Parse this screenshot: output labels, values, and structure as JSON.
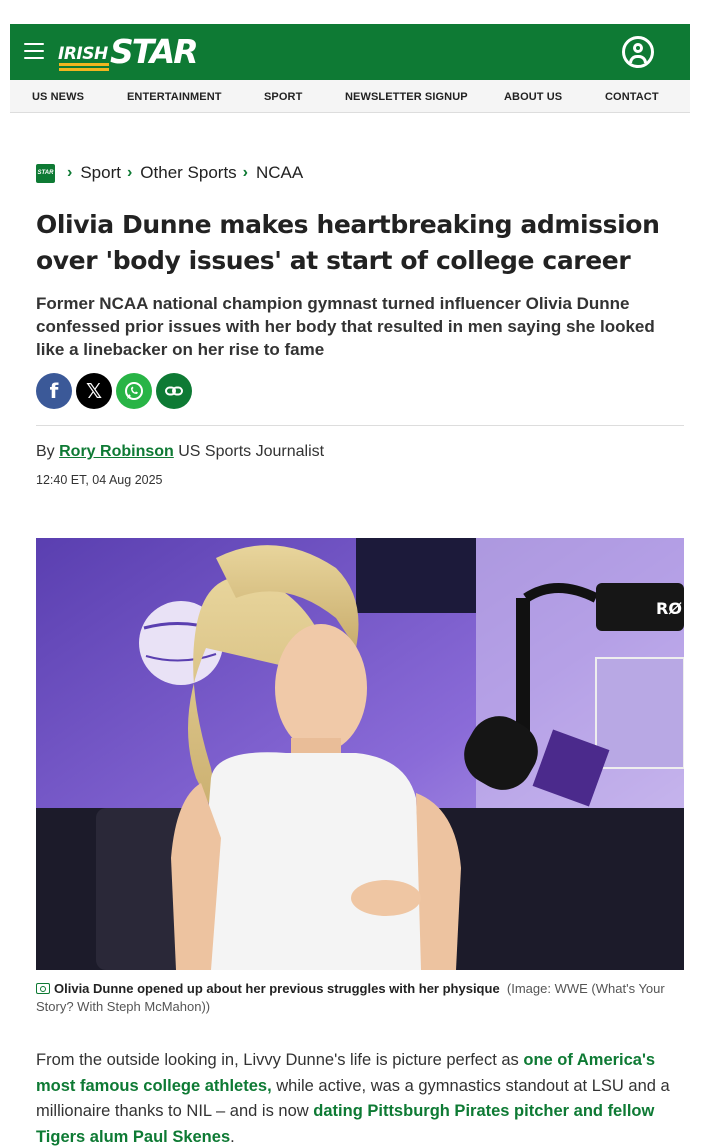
{
  "header": {
    "logo_irish": "IRISH",
    "logo_star": "STAR",
    "nav": [
      "US NEWS",
      "ENTERTAINMENT",
      "SPORT",
      "NEWSLETTER SIGNUP",
      "ABOUT US",
      "CONTACT"
    ]
  },
  "breadcrumb": {
    "logo_text": "STAR",
    "items": [
      "Sport",
      "Other Sports",
      "NCAA"
    ]
  },
  "article": {
    "headline": "Olivia Dunne makes heartbreaking admission over 'body issues' at start of college career",
    "standfirst": "Former NCAA national champion gymnast turned influencer Olivia Dunne confessed prior issues with her body that resulted in men saying she looked like a linebacker on her rise to fame",
    "by_prefix": "By",
    "author": "Rory Robinson",
    "author_role": "US Sports Journalist",
    "timestamp": "12:40 ET, 04 Aug 2025",
    "share_buttons": [
      "facebook-icon",
      "x-icon",
      "whatsapp-icon",
      "link-icon"
    ],
    "caption": "Olivia Dunne opened up about her previous struggles with her physique",
    "caption_credit": "(Image: WWE (What's Your Story? With Steph McMahon))",
    "body": {
      "part1": "From the outside looking in, Livvy Dunne's life is picture perfect as ",
      "link1": "one of America's most famous college athletes,",
      "part2": " while active, was a gymnastics standout at LSU and a millionaire thanks to NIL – and is now ",
      "link2": "dating Pittsburgh Pirates pitcher and fellow Tigers alum Paul Skenes",
      "part3": "."
    }
  },
  "colors": {
    "brand_green": "#0e7a34",
    "accent_gold": "#f2b61f",
    "facebook": "#3b5998",
    "whatsapp": "#28b446"
  }
}
